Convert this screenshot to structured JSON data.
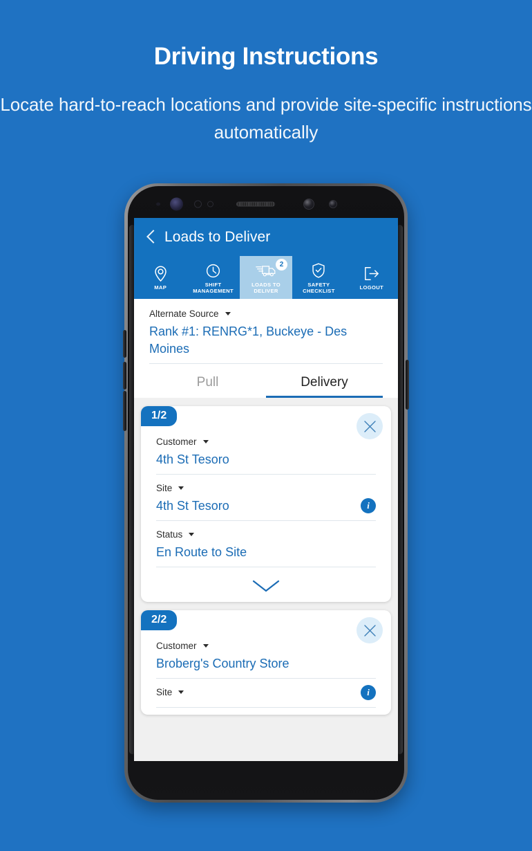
{
  "promo": {
    "title": "Driving Instructions",
    "subtitle": "Locate hard-to-reach locations and provide site-specific instructions automatically"
  },
  "colors": {
    "background": "#1f72c2",
    "header": "#1472bf",
    "link": "#1b6cb5",
    "active_tab_bg": "#a9cfe9",
    "card_badge": "#1472bf",
    "close_circle": "#dcedf9"
  },
  "app": {
    "header": {
      "back_icon": "chevron-left-icon",
      "title": "Loads to Deliver"
    },
    "tabs": [
      {
        "icon": "map-pin-icon",
        "label": "MAP",
        "active": false,
        "badge": null
      },
      {
        "icon": "clock-icon",
        "label": "SHIFT MANAGEMENT",
        "active": false,
        "badge": null
      },
      {
        "icon": "truck-icon",
        "label": "LOADS TO DELIVER",
        "active": true,
        "badge": "2"
      },
      {
        "icon": "shield-check-icon",
        "label": "SAFETY CHECKLIST",
        "active": false,
        "badge": null
      },
      {
        "icon": "logout-icon",
        "label": "LOGOUT",
        "active": false,
        "badge": null
      }
    ],
    "source": {
      "label": "Alternate Source",
      "value": "Rank #1: RENRG*1, Buckeye - Des Moines"
    },
    "segments": [
      {
        "label": "Pull",
        "active": false
      },
      {
        "label": "Delivery",
        "active": true
      }
    ],
    "cards": [
      {
        "badge": "1/2",
        "close_icon": "close-icon",
        "rows": [
          {
            "label": "Customer",
            "value": "4th St Tesoro",
            "info": false
          },
          {
            "label": "Site",
            "value": "4th St Tesoro",
            "info": true,
            "info_icon": "info-icon"
          },
          {
            "label": "Status",
            "value": "En Route to Site",
            "info": false
          }
        ],
        "expand_icon": "chevron-down-icon"
      },
      {
        "badge": "2/2",
        "close_icon": "close-icon",
        "rows": [
          {
            "label": "Customer",
            "value": "Broberg's Country Store",
            "info": false
          },
          {
            "label": "Site",
            "value": "",
            "info": false
          }
        ],
        "expand_icon": null
      }
    ]
  }
}
